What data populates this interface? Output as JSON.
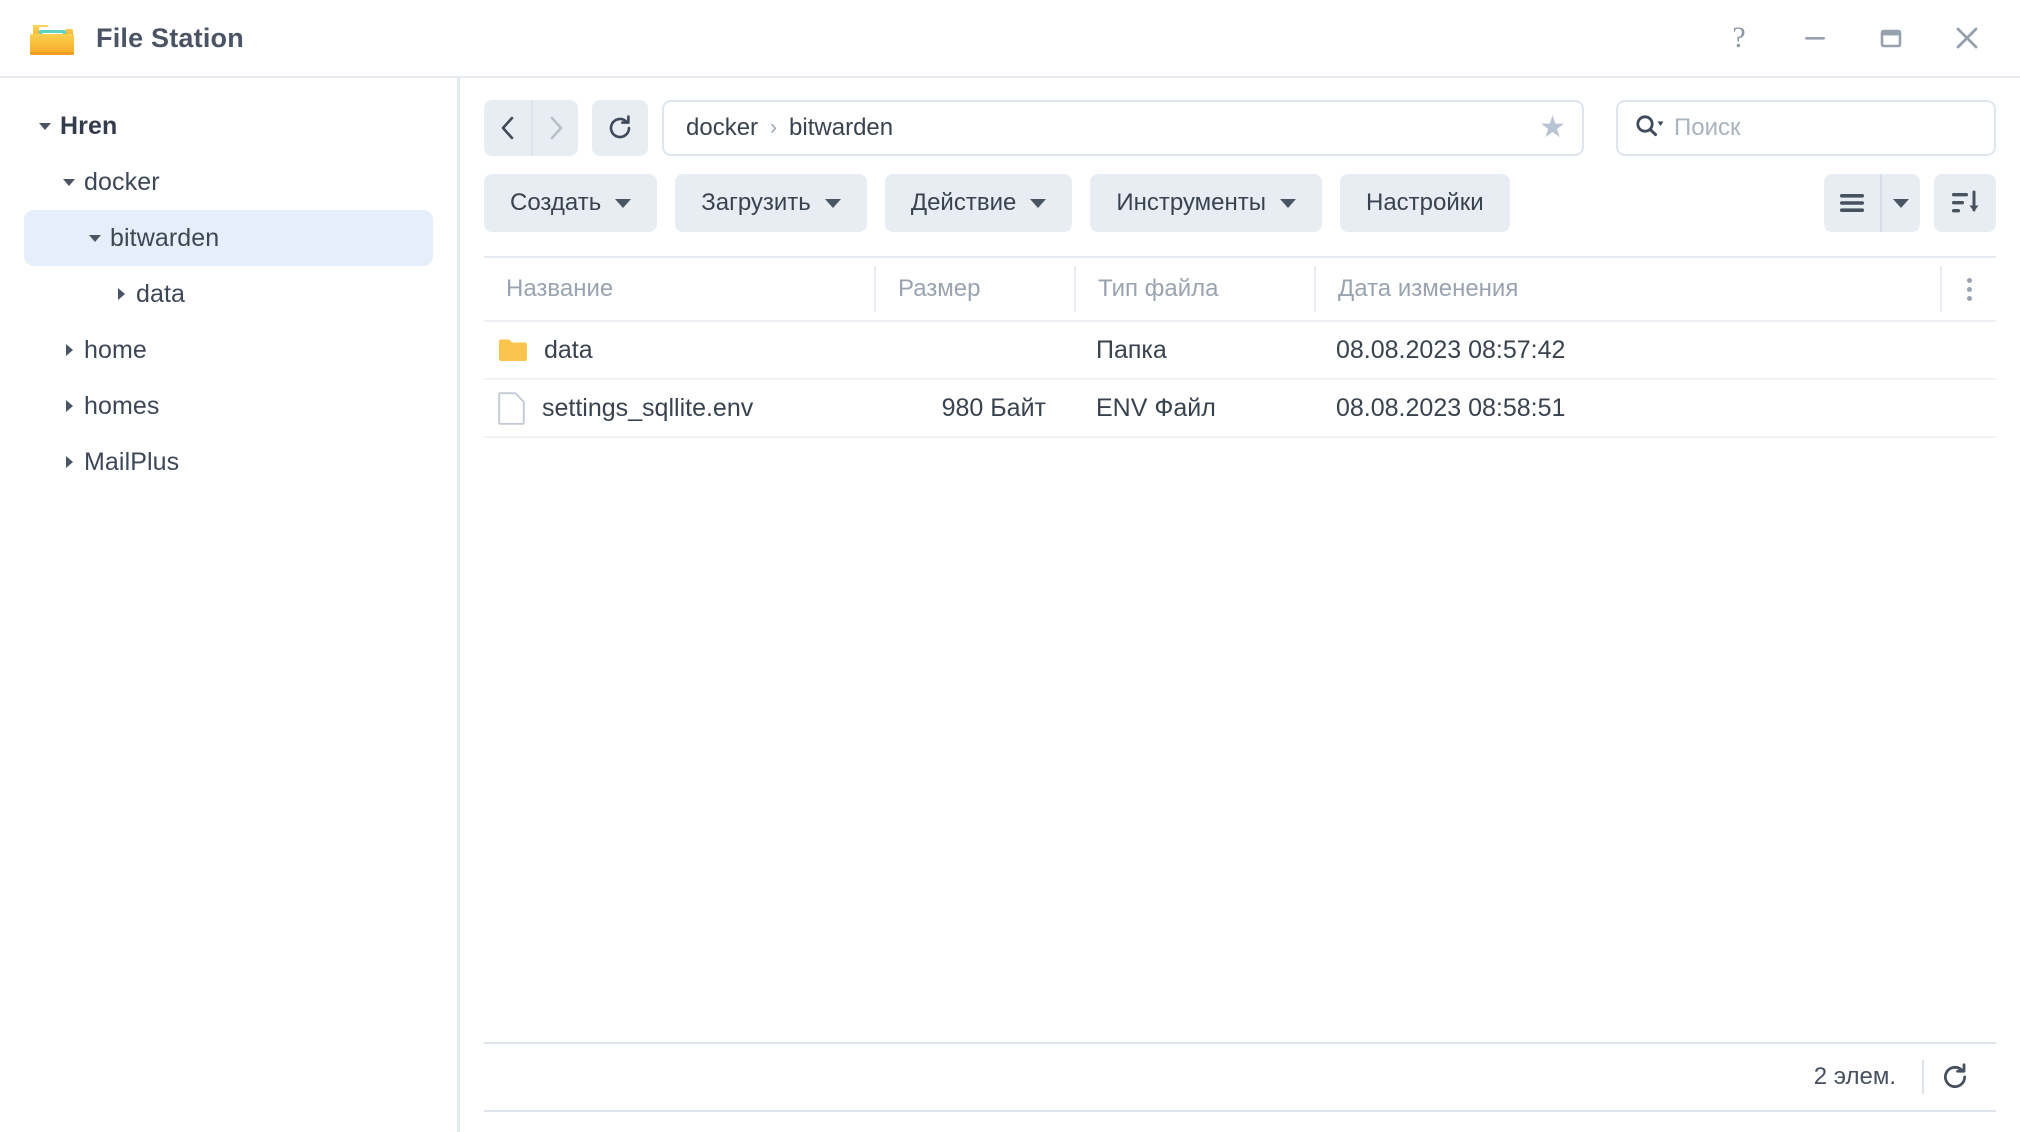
{
  "window": {
    "title": "File Station",
    "app_icon": "folder-open-icon",
    "controls": [
      {
        "name": "help-button",
        "glyph": "?"
      },
      {
        "name": "minimize-button",
        "glyph": "minimize-icon"
      },
      {
        "name": "maximize-button",
        "glyph": "maximize-icon"
      },
      {
        "name": "close-button",
        "glyph": "close-icon"
      }
    ]
  },
  "sidebar": {
    "items": [
      {
        "label": "Hren",
        "level": 0,
        "expanded": true,
        "has_children": true,
        "selected": false,
        "root": true
      },
      {
        "label": "docker",
        "level": 1,
        "expanded": true,
        "has_children": true,
        "selected": false,
        "root": false
      },
      {
        "label": "bitwarden",
        "level": 2,
        "expanded": true,
        "has_children": true,
        "selected": true,
        "root": false
      },
      {
        "label": "data",
        "level": 3,
        "expanded": false,
        "has_children": true,
        "selected": false,
        "root": false
      },
      {
        "label": "home",
        "level": 1,
        "expanded": false,
        "has_children": true,
        "selected": false,
        "root": false
      },
      {
        "label": "homes",
        "level": 1,
        "expanded": false,
        "has_children": true,
        "selected": false,
        "root": false
      },
      {
        "label": "MailPlus",
        "level": 1,
        "expanded": false,
        "has_children": true,
        "selected": false,
        "root": false
      }
    ]
  },
  "nav": {
    "back": {
      "name": "back-button",
      "enabled": true
    },
    "forward": {
      "name": "forward-button",
      "enabled": false
    },
    "refresh": {
      "name": "refresh-button"
    },
    "breadcrumb": [
      "docker",
      "bitwarden"
    ],
    "breadcrumb_separator": "›",
    "favorite_star": "★"
  },
  "search": {
    "placeholder": "Поиск",
    "value": ""
  },
  "toolbar": {
    "buttons": [
      {
        "label": "Создать",
        "has_caret": true
      },
      {
        "label": "Загрузить",
        "has_caret": true
      },
      {
        "label": "Действие",
        "has_caret": true
      },
      {
        "label": "Инструменты",
        "has_caret": true
      },
      {
        "label": "Настройки",
        "has_caret": false
      }
    ],
    "view_icon": "list-view-icon",
    "view_caret": "chevron-down-icon",
    "sort_icon": "sort-descending-icon"
  },
  "table": {
    "columns": [
      {
        "key": "name",
        "label": "Название"
      },
      {
        "key": "size",
        "label": "Размер"
      },
      {
        "key": "type",
        "label": "Тип файла"
      },
      {
        "key": "date",
        "label": "Дата изменения"
      }
    ],
    "column_menu_icon": "more-vertical-icon",
    "rows": [
      {
        "icon": "folder-icon",
        "name": "data",
        "size": "",
        "type": "Папка",
        "date": "08.08.2023 08:57:42"
      },
      {
        "icon": "file-icon",
        "name": "settings_sqllite.env",
        "size": "980 Байт",
        "type": "ENV Файл",
        "date": "08.08.2023 08:58:51"
      }
    ]
  },
  "statusbar": {
    "count_text": "2 элем.",
    "refresh_icon": "refresh-icon"
  },
  "colors": {
    "folder": "#fbc44d",
    "selection": "#e7eefb",
    "toolbar_button": "#e8edf4",
    "text": "#39434f",
    "muted": "#9aa3b0",
    "border": "#e6eaf1"
  }
}
